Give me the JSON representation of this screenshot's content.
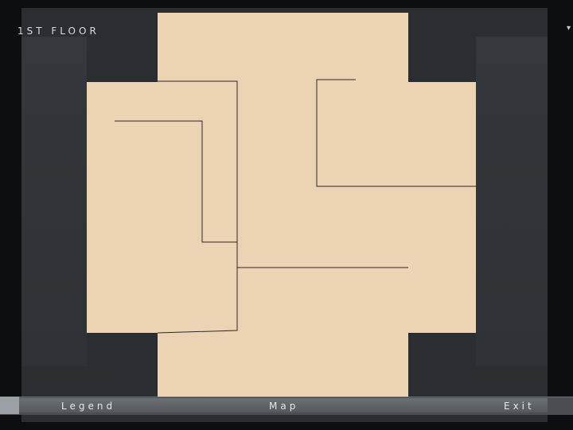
{
  "hud": {
    "floor_label": "1ST FLOOR"
  },
  "map": {
    "room_fill": "#ecd3b4",
    "wall_color": "#2a2a2a"
  },
  "bottom_menu": {
    "legend_label": "Legend",
    "map_label": "Map",
    "exit_label": "Exit"
  }
}
